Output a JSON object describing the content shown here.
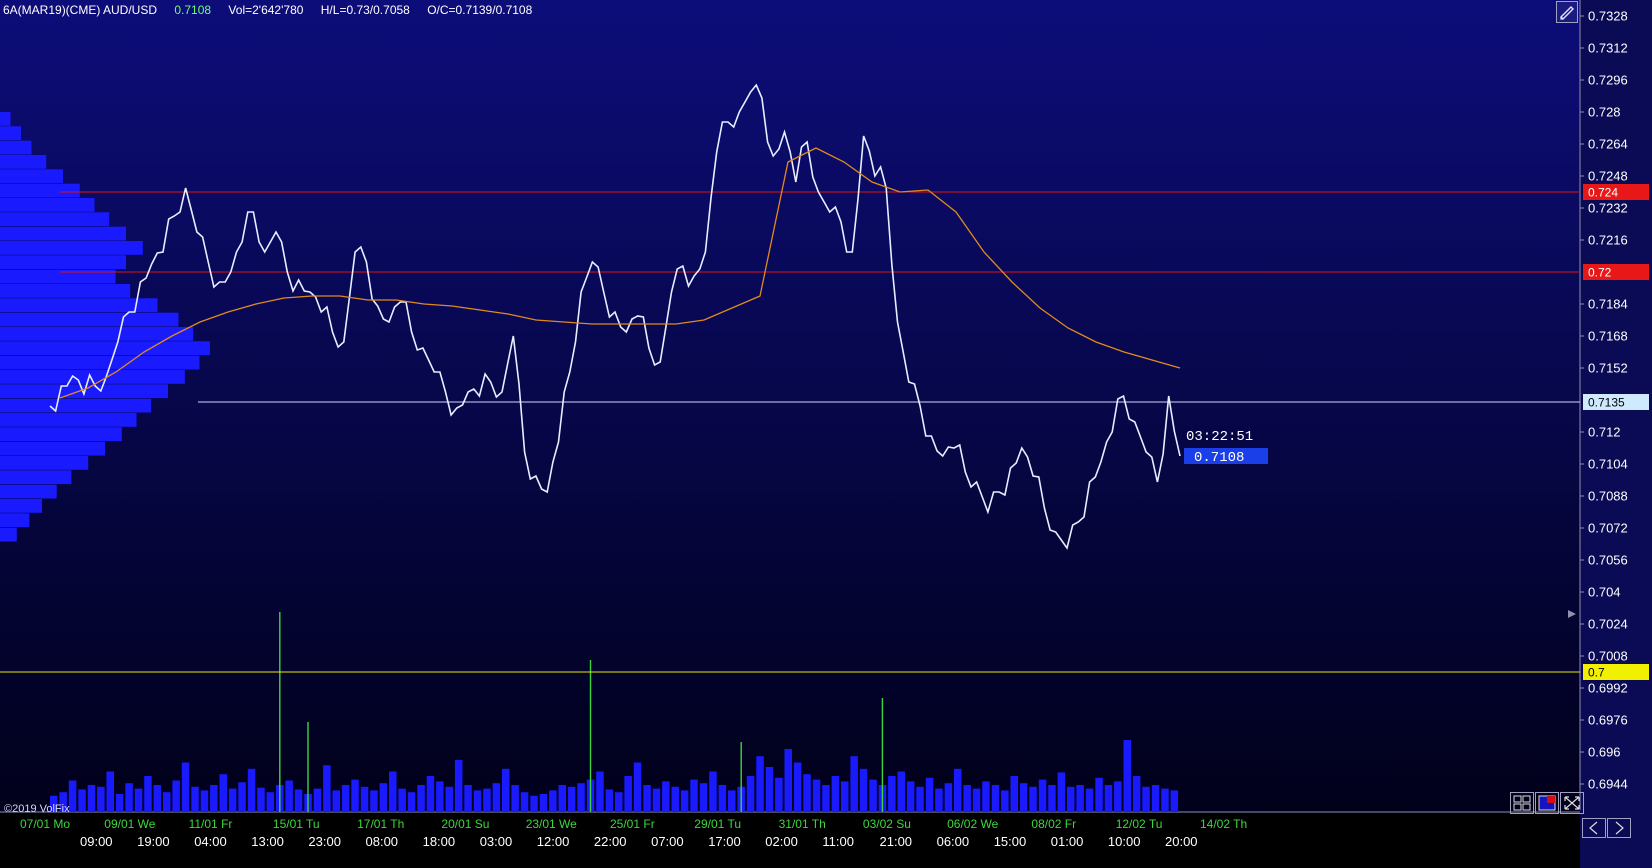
{
  "header": {
    "symbol": "6A(MAR19)(CME) AUD/USD",
    "last": "0.7108",
    "volume": "Vol=2'642'780",
    "high_low": "H/L=0.73/0.7058",
    "open_close": "O/C=0.7139/0.7108"
  },
  "copyright": "©2019 VolFix",
  "countdown": "03:22:51",
  "current_price_tag": "0.7108",
  "colors": {
    "price_line": "#e6eeff",
    "moving_average": "#e08a1e",
    "volume_profile": "#1a1aff",
    "volume_bars": "#1a1aff",
    "volume_spike": "#3cd63c",
    "level_red": "#e01010",
    "level_white": "#c8d8ff",
    "level_yellow": "#e8e800",
    "date_label": "#3cd63c",
    "time_label": "#ffffff"
  },
  "icons": [
    "pencil-icon",
    "grid-icon",
    "layout-icon",
    "expand-icon",
    "arrow-left-icon",
    "arrow-right-icon"
  ],
  "chart_data": {
    "type": "line",
    "ylim": [
      0.6935,
      0.7332
    ],
    "y_ticks": [
      "0.7328",
      "0.7312",
      "0.7296",
      "0.728",
      "0.7264",
      "0.7248",
      "0.7232",
      "0.7216",
      "0.72",
      "0.7184",
      "0.7168",
      "0.7152",
      "0.7135",
      "0.712",
      "0.7104",
      "0.7088",
      "0.7072",
      "0.7056",
      "0.704",
      "0.7024",
      "0.7008",
      "0.6992",
      "0.6976",
      "0.696",
      "0.6944"
    ],
    "x_date_labels": [
      "07/01 Mo",
      "09/01 We",
      "11/01 Fr",
      "15/01 Tu",
      "17/01 Th",
      "20/01 Su",
      "23/01 We",
      "25/01 Fr",
      "29/01 Tu",
      "31/01 Th",
      "03/02 Su",
      "06/02 We",
      "08/02 Fr",
      "12/02 Tu",
      "14/02 Th"
    ],
    "x_time_labels": [
      "09:00",
      "19:00",
      "04:00",
      "13:00",
      "23:00",
      "08:00",
      "18:00",
      "03:00",
      "12:00",
      "22:00",
      "07:00",
      "17:00",
      "02:00",
      "11:00",
      "21:00",
      "06:00",
      "15:00",
      "01:00",
      "10:00",
      "20:00"
    ],
    "price_series": [
      0.7133,
      0.7143,
      0.7148,
      0.7139,
      0.7143,
      0.7148,
      0.7165,
      0.718,
      0.7195,
      0.7204,
      0.721,
      0.7228,
      0.7242,
      0.722,
      0.7205,
      0.7195,
      0.72,
      0.7215,
      0.723,
      0.721,
      0.722,
      0.72,
      0.7196,
      0.719,
      0.718,
      0.717,
      0.7165,
      0.721,
      0.7205,
      0.7183,
      0.7175,
      0.7185,
      0.717,
      0.7162,
      0.715,
      0.714,
      0.7132,
      0.714,
      0.7138,
      0.7145,
      0.714,
      0.7168,
      0.711,
      0.7098,
      0.709,
      0.7115,
      0.715,
      0.719,
      0.7205,
      0.719,
      0.718,
      0.717,
      0.7178,
      0.7162,
      0.7155,
      0.719,
      0.7203,
      0.7198,
      0.721,
      0.726,
      0.7275,
      0.728,
      0.729,
      0.7287,
      0.7258,
      0.727,
      0.7245,
      0.7265,
      0.724,
      0.723,
      0.7225,
      0.721,
      0.7268,
      0.7248,
      0.7242,
      0.7175,
      0.7145,
      0.7133,
      0.7118,
      0.7108,
      0.7112,
      0.71,
      0.7095,
      0.708,
      0.709,
      0.7102,
      0.7112,
      0.7098,
      0.7082,
      0.707,
      0.7062,
      0.7075,
      0.7095,
      0.7105,
      0.712,
      0.7138,
      0.7125,
      0.711,
      0.7095,
      0.7138,
      0.7108
    ],
    "ma_series": [
      0.7137,
      0.7142,
      0.715,
      0.716,
      0.7168,
      0.7175,
      0.718,
      0.7184,
      0.7187,
      0.7188,
      0.7188,
      0.7186,
      0.7186,
      0.7184,
      0.7183,
      0.7181,
      0.7179,
      0.7176,
      0.7175,
      0.7174,
      0.7174,
      0.7174,
      0.7174,
      0.7176,
      0.7182,
      0.7188,
      0.7255,
      0.7262,
      0.7255,
      0.7245,
      0.724,
      0.7241,
      0.723,
      0.721,
      0.7195,
      0.7182,
      0.7172,
      0.7165,
      0.716,
      0.7156,
      0.7152
    ],
    "levels": [
      {
        "label": "0.724",
        "value": 0.724,
        "color": "#e01010"
      },
      {
        "label": "0.72",
        "value": 0.72,
        "color": "#e01010"
      },
      {
        "label": "0.7135",
        "value": 0.7135,
        "color": "#c8d8ff"
      },
      {
        "label": "0.7",
        "value": 0.7,
        "color": "#e8e800"
      }
    ],
    "current_price": 0.7108,
    "volume_bars": [
      0.18,
      0.22,
      0.35,
      0.25,
      0.3,
      0.28,
      0.45,
      0.2,
      0.32,
      0.26,
      0.4,
      0.3,
      0.22,
      0.35,
      0.55,
      0.28,
      0.24,
      0.3,
      0.42,
      0.26,
      0.33,
      0.48,
      0.27,
      0.22,
      0.3,
      0.35,
      0.25,
      0.2,
      0.26,
      0.52,
      0.24,
      0.3,
      0.36,
      0.28,
      0.24,
      0.32,
      0.45,
      0.26,
      0.22,
      0.3,
      0.4,
      0.34,
      0.28,
      0.58,
      0.3,
      0.24,
      0.26,
      0.32,
      0.48,
      0.3,
      0.22,
      0.18,
      0.2,
      0.24,
      0.3,
      0.28,
      0.32,
      0.36,
      0.45,
      0.25,
      0.22,
      0.4,
      0.55,
      0.3,
      0.26,
      0.34,
      0.28,
      0.24,
      0.36,
      0.32,
      0.45,
      0.3,
      0.24,
      0.28,
      0.4,
      0.62,
      0.5,
      0.38,
      0.7,
      0.55,
      0.42,
      0.36,
      0.3,
      0.4,
      0.34,
      0.62,
      0.48,
      0.36,
      0.3,
      0.4,
      0.45,
      0.34,
      0.28,
      0.38,
      0.26,
      0.32,
      0.48,
      0.3,
      0.26,
      0.34,
      0.3,
      0.24,
      0.4,
      0.32,
      0.28,
      0.36,
      0.3,
      0.44,
      0.28,
      0.3,
      0.26,
      0.38,
      0.3,
      0.34,
      0.8,
      0.4,
      0.28,
      0.3,
      0.26,
      0.24
    ],
    "volume_spikes": [
      {
        "index": 24,
        "value": 1.0
      },
      {
        "index": 27,
        "value": 0.45
      },
      {
        "index": 57,
        "value": 0.76
      },
      {
        "index": 88,
        "value": 0.57
      },
      {
        "index": 73,
        "value": 0.35
      }
    ],
    "volume_profile": [
      0.05,
      0.1,
      0.15,
      0.22,
      0.3,
      0.38,
      0.45,
      0.52,
      0.6,
      0.68,
      0.6,
      0.55,
      0.62,
      0.75,
      0.85,
      0.92,
      1.0,
      0.95,
      0.88,
      0.8,
      0.72,
      0.65,
      0.58,
      0.5,
      0.42,
      0.34,
      0.27,
      0.2,
      0.14,
      0.08
    ]
  }
}
